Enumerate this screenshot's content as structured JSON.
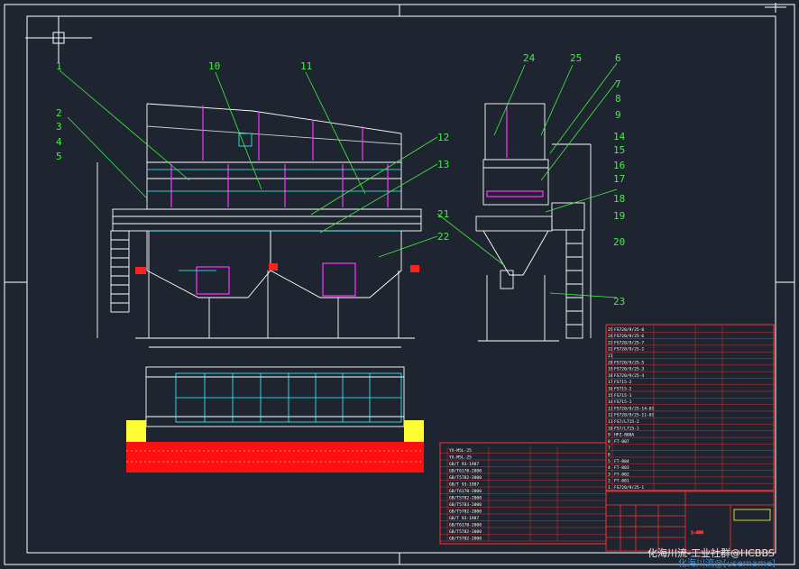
{
  "callouts": [
    "1",
    "2",
    "3",
    "4",
    "5",
    "10",
    "11",
    "12",
    "13",
    "21",
    "22",
    "24",
    "25",
    "6",
    "7",
    "8",
    "9",
    "14",
    "15",
    "16",
    "17",
    "18",
    "19",
    "20",
    "23"
  ],
  "upper_table_rows": [
    {
      "no": "25",
      "code": "FS720/9/25-0"
    },
    {
      "no": "24",
      "code": "FS720/9/25-6"
    },
    {
      "no": "23",
      "code": "FS720/9/25-7"
    },
    {
      "no": "22",
      "code": "FS720/9/25-2"
    },
    {
      "no": "21",
      "code": ""
    },
    {
      "no": "20",
      "code": "FS720/9/25-5"
    },
    {
      "no": "19",
      "code": "FS720/9/25-3"
    },
    {
      "no": "18",
      "code": "FS720/9/25-4"
    },
    {
      "no": "17",
      "code": "FS715-2"
    },
    {
      "no": "16",
      "code": "FS715-2"
    },
    {
      "no": "15",
      "code": "FS715-1"
    },
    {
      "no": "14",
      "code": "FS715-1"
    },
    {
      "no": "13",
      "code": "FS720/9/25-14-01"
    },
    {
      "no": "12",
      "code": "FS720/9/25-11-01"
    },
    {
      "no": "11",
      "code": "FS7/L715-2"
    },
    {
      "no": "10",
      "code": "FS7/L715-1"
    },
    {
      "no": "9",
      "code": "HFZ-800A"
    },
    {
      "no": "8",
      "code": "FT-807"
    },
    {
      "no": "7",
      "code": ""
    },
    {
      "no": "6",
      "code": ""
    },
    {
      "no": "5",
      "code": "FT-804"
    },
    {
      "no": "4",
      "code": "FT-803"
    },
    {
      "no": "3",
      "code": "FT-802"
    },
    {
      "no": "2",
      "code": "FT-801"
    },
    {
      "no": "1",
      "code": "FS720/9/25-1"
    }
  ],
  "lower_table_rows": [
    {
      "no": "",
      "code": "YX-M5L-25"
    },
    {
      "no": "",
      "code": "YX-M5L-25"
    },
    {
      "no": "",
      "code": "GB/T 93-1987"
    },
    {
      "no": "",
      "code": "GB/T6170-2000"
    },
    {
      "no": "",
      "code": "GB/T5782-2000"
    },
    {
      "no": "",
      "code": "GB/T 93-1987"
    },
    {
      "no": "",
      "code": "GB/T6170-2000"
    },
    {
      "no": "",
      "code": "GB/T5782-2000"
    },
    {
      "no": "",
      "code": "GB/T5783-2000"
    },
    {
      "no": "",
      "code": "GB/T5782-2000"
    },
    {
      "no": "",
      "code": "GB/T 93-1987"
    },
    {
      "no": "",
      "code": "GB/T6170-2000"
    },
    {
      "no": "",
      "code": "GB/T5782-2000"
    },
    {
      "no": "",
      "code": "GB/T5782-2000"
    }
  ],
  "title_block": {
    "drawing_no": "1-400"
  },
  "watermark": "化海川流-工业社群@HCBBS",
  "watermark2": "化海川流@[username]"
}
